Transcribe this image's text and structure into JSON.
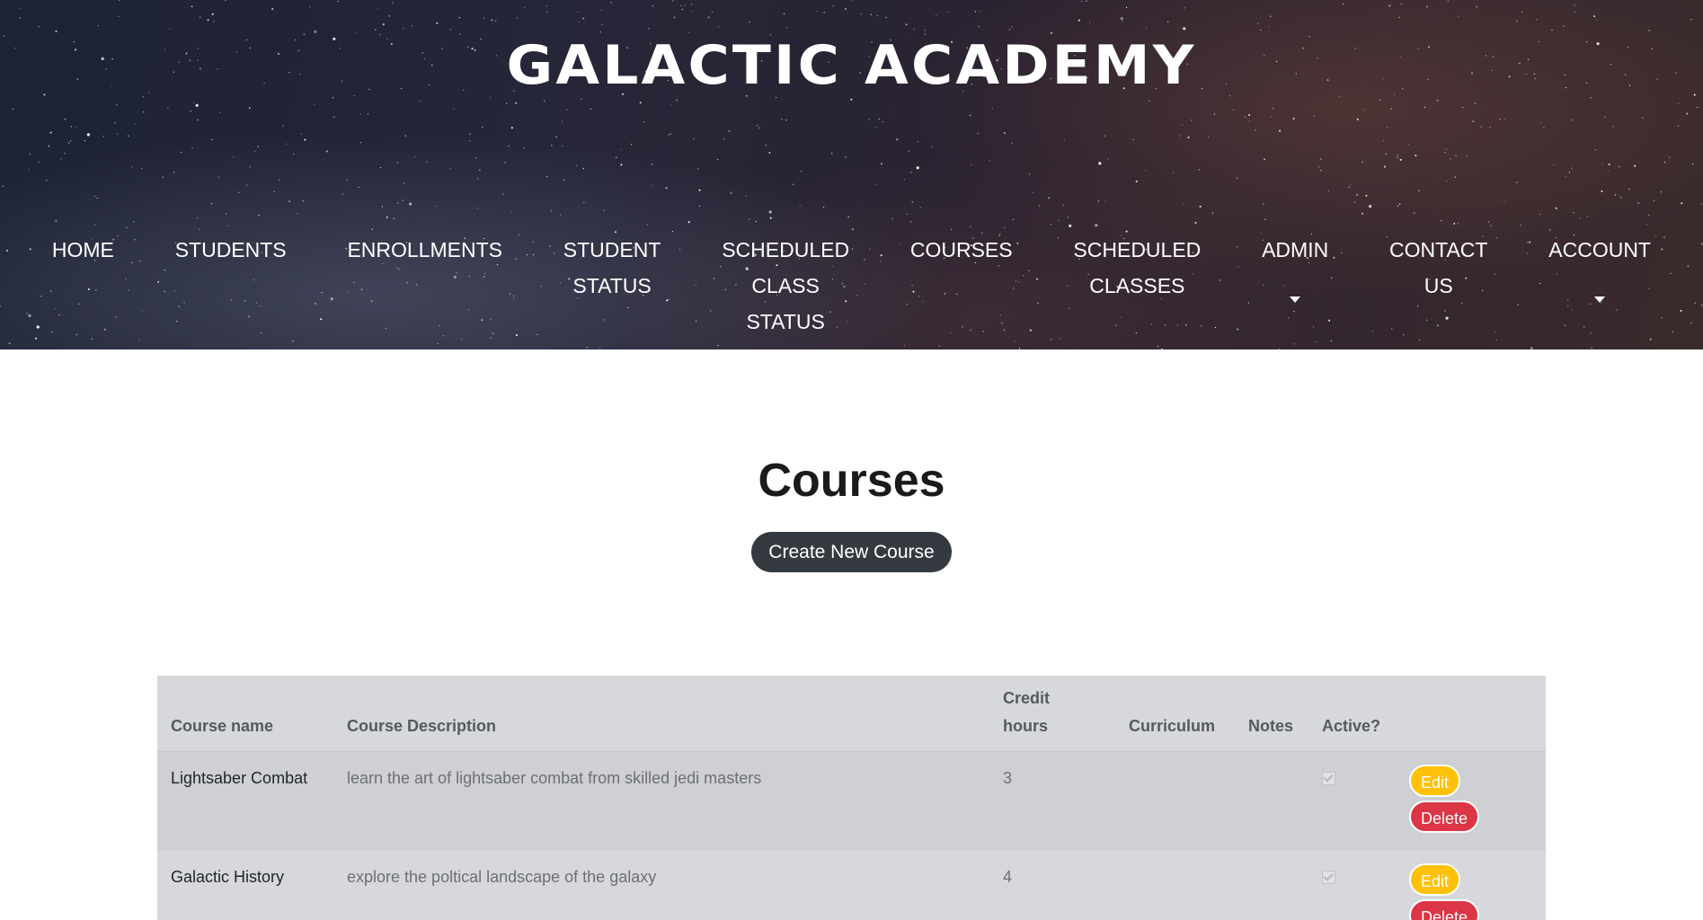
{
  "site": {
    "title": "GALACTIC ACADEMY"
  },
  "nav": {
    "items": [
      {
        "label": "HOME"
      },
      {
        "label": "STUDENTS"
      },
      {
        "label": "ENROLLMENTS"
      },
      {
        "label": "STUDENT\nSTATUS"
      },
      {
        "label": "SCHEDULED\nCLASS\nSTATUS"
      },
      {
        "label": "COURSES"
      },
      {
        "label": "SCHEDULED\nCLASSES"
      },
      {
        "label": "ADMIN"
      },
      {
        "label": "CONTACT\nUS"
      },
      {
        "label": "ACCOUNT"
      }
    ]
  },
  "page": {
    "title": "Courses",
    "create_button": "Create New Course"
  },
  "table": {
    "headers": {
      "name": "Course name",
      "description": "Course Description",
      "credit_hours": "Credit\nhours",
      "curriculum": "Curriculum",
      "notes": "Notes",
      "active": "Active?"
    },
    "rows": [
      {
        "name": "Lightsaber Combat",
        "description": "learn the art of lightsaber combat from skilled jedi masters",
        "credit_hours": "3",
        "curriculum": "",
        "notes": "",
        "active": true,
        "edit_label": "Edit",
        "delete_label": "Delete"
      },
      {
        "name": "Galactic History",
        "description": "explore the poltical landscape of the galaxy",
        "credit_hours": "4",
        "curriculum": "",
        "notes": "",
        "active": true,
        "edit_label": "Edit",
        "delete_label": "Delete"
      }
    ]
  }
}
